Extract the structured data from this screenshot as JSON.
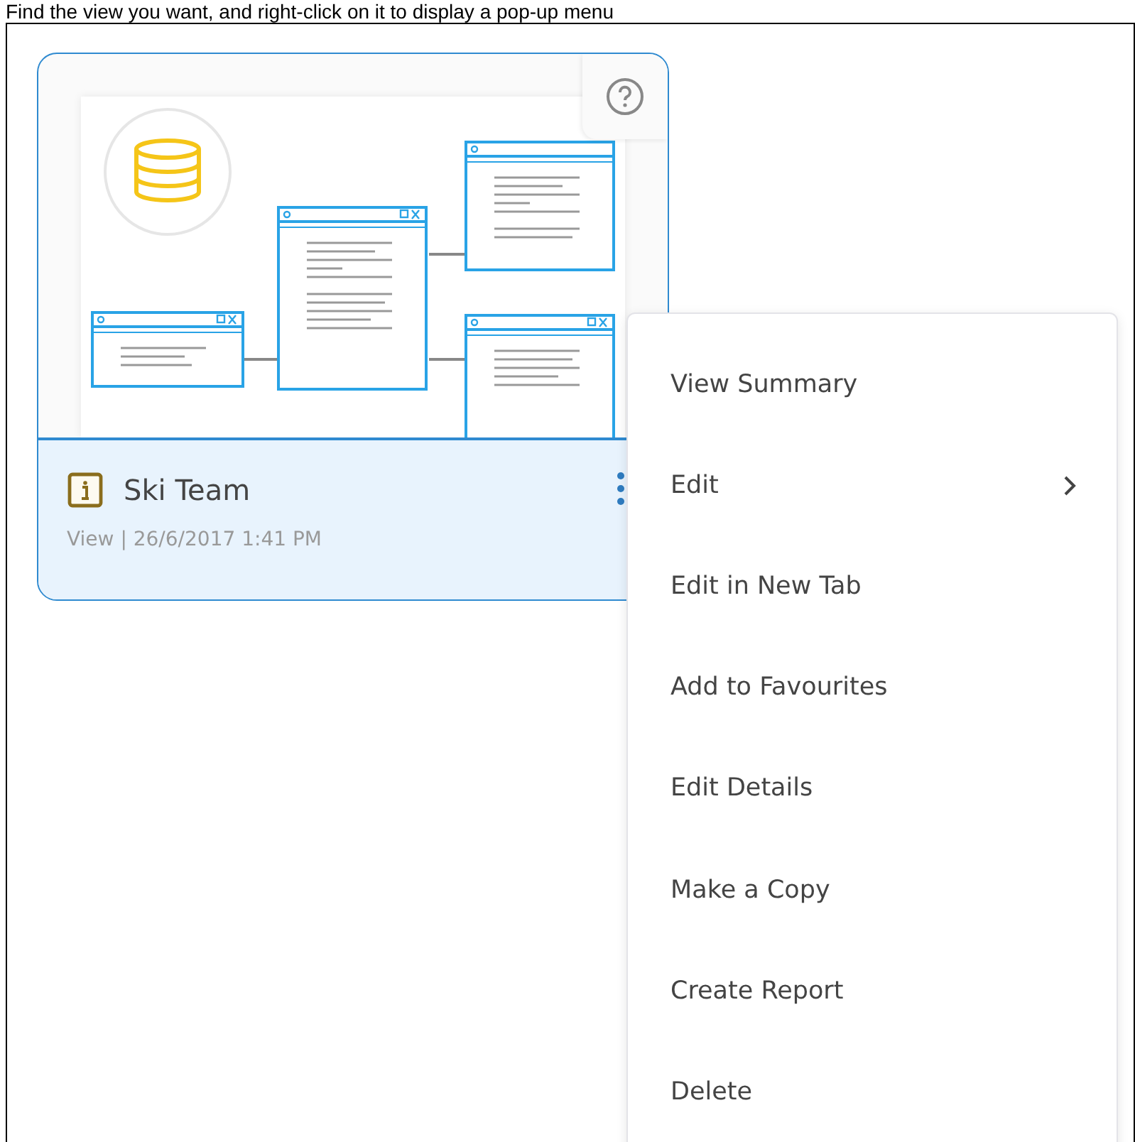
{
  "caption": "Find the view you want, and right-click on it to display a pop-up menu",
  "card": {
    "title": "Ski Team",
    "type": "View",
    "separator": "|",
    "date": "26/6/2017 1:41 PM",
    "selected": true
  },
  "menu": {
    "items": [
      {
        "label": "View Summary",
        "has_submenu": false
      },
      {
        "label": "Edit",
        "has_submenu": true
      },
      {
        "label": "Edit in New Tab",
        "has_submenu": false
      },
      {
        "label": "Add to Favourites",
        "has_submenu": false
      },
      {
        "label": "Edit Details",
        "has_submenu": false
      },
      {
        "label": "Make a Copy",
        "has_submenu": false
      },
      {
        "label": "Create Report",
        "has_submenu": false
      },
      {
        "label": "Delete",
        "has_submenu": false
      }
    ]
  }
}
